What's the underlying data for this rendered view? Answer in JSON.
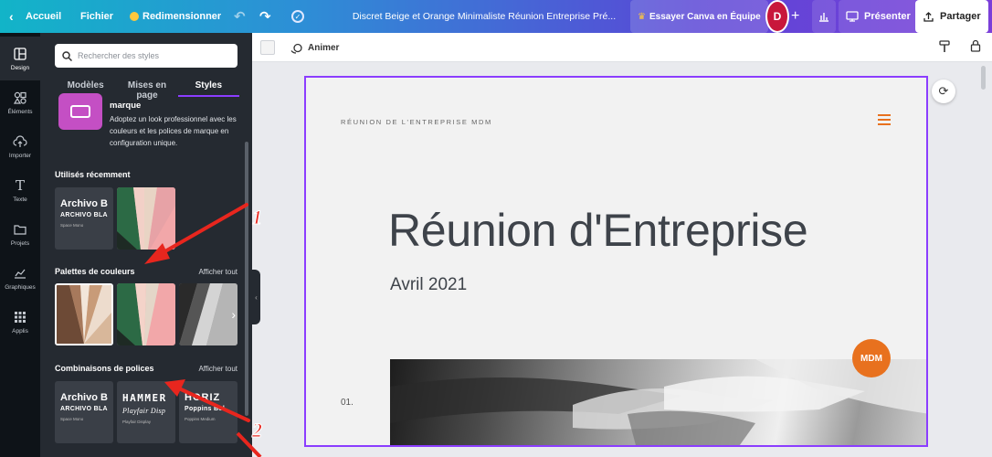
{
  "topbar": {
    "home": "Accueil",
    "file": "Fichier",
    "resize": "Redimensionner",
    "doc_title": "Discret Beige et Orange Minimaliste Réunion Entreprise Pré...",
    "try_team": "Essayer Canva en Équipe",
    "avatar_initial": "D",
    "present": "Présenter",
    "share": "Partager"
  },
  "rail": [
    {
      "label": "Design",
      "icon": "layout-icon"
    },
    {
      "label": "Éléments",
      "icon": "shapes-icon"
    },
    {
      "label": "Importer",
      "icon": "cloud-upload-icon"
    },
    {
      "label": "Texte",
      "icon": "text-icon"
    },
    {
      "label": "Projets",
      "icon": "folder-icon"
    },
    {
      "label": "Graphiques",
      "icon": "chart-icon"
    },
    {
      "label": "Applis",
      "icon": "apps-grid-icon"
    }
  ],
  "panel": {
    "search_placeholder": "Rechercher des styles",
    "tabs": [
      "Modèles",
      "Mises en page",
      "Styles"
    ],
    "brand_title": "marque",
    "brand_desc": "Adoptez un look professionnel avec les couleurs et les polices de marque en configuration unique.",
    "recent_title": "Utilisés récemment",
    "palettes_title": "Palettes de couleurs",
    "palettes_see_all": "Afficher tout",
    "fonts_title": "Combinaisons de polices",
    "fonts_see_all": "Afficher tout",
    "font_samples": [
      {
        "l1": "Archivo B",
        "l2": "ARCHIVO BLA",
        "l3": "Space Mono"
      },
      {
        "l1": "HAMMER",
        "l2": "Playfair Disp",
        "l3": "Playfair Display"
      },
      {
        "l1": "HORIZ",
        "l2": "Poppins Bol",
        "l3": "Poppins Medium"
      }
    ]
  },
  "editor": {
    "animate": "Animer"
  },
  "slide": {
    "meeting_label": "RÉUNION DE L'ENTREPRISE MDM",
    "title": "Réunion d'Entreprise",
    "date": "Avril 2021",
    "number": "01.",
    "badge": "MDM"
  },
  "annotations": [
    "1",
    "2"
  ],
  "colors": {
    "accent": "#8b3dff",
    "orange": "#e8711e",
    "annotation_red": "#e8261e"
  }
}
